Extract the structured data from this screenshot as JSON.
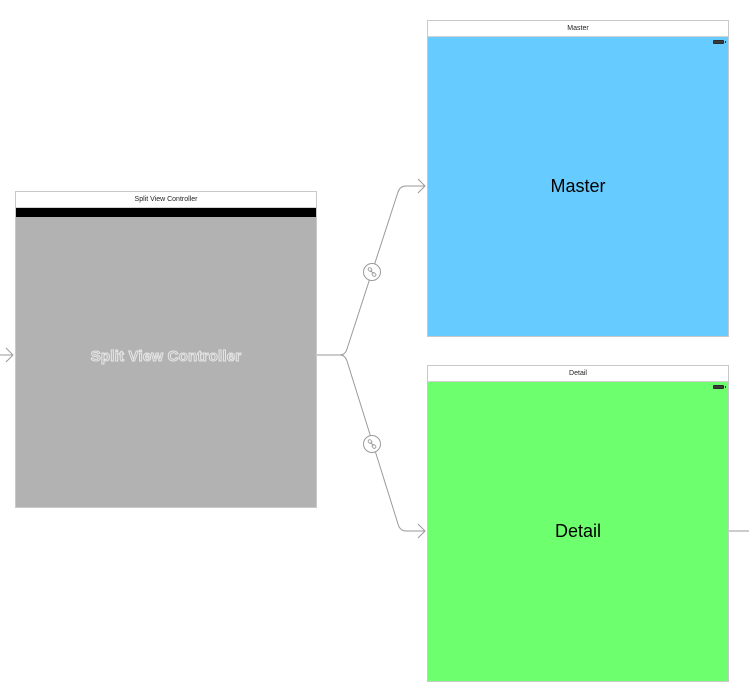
{
  "storyboard": {
    "split_scene": {
      "title": "Split View Controller",
      "placeholder": "Split View Controller",
      "view_color": "#b2b2b2"
    },
    "master_scene": {
      "title": "Master",
      "label": "Master",
      "view_color": "#66ccff"
    },
    "detail_scene": {
      "title": "Detail",
      "label": "Detail",
      "view_color": "#6dff6d"
    },
    "segues": [
      {
        "name": "relationship-segue-master",
        "icon": "relationship-link-icon"
      },
      {
        "name": "relationship-segue-detail",
        "icon": "relationship-link-icon"
      }
    ],
    "colors": {
      "connector": "#9a9a9a",
      "status_bar": "#000000"
    }
  }
}
